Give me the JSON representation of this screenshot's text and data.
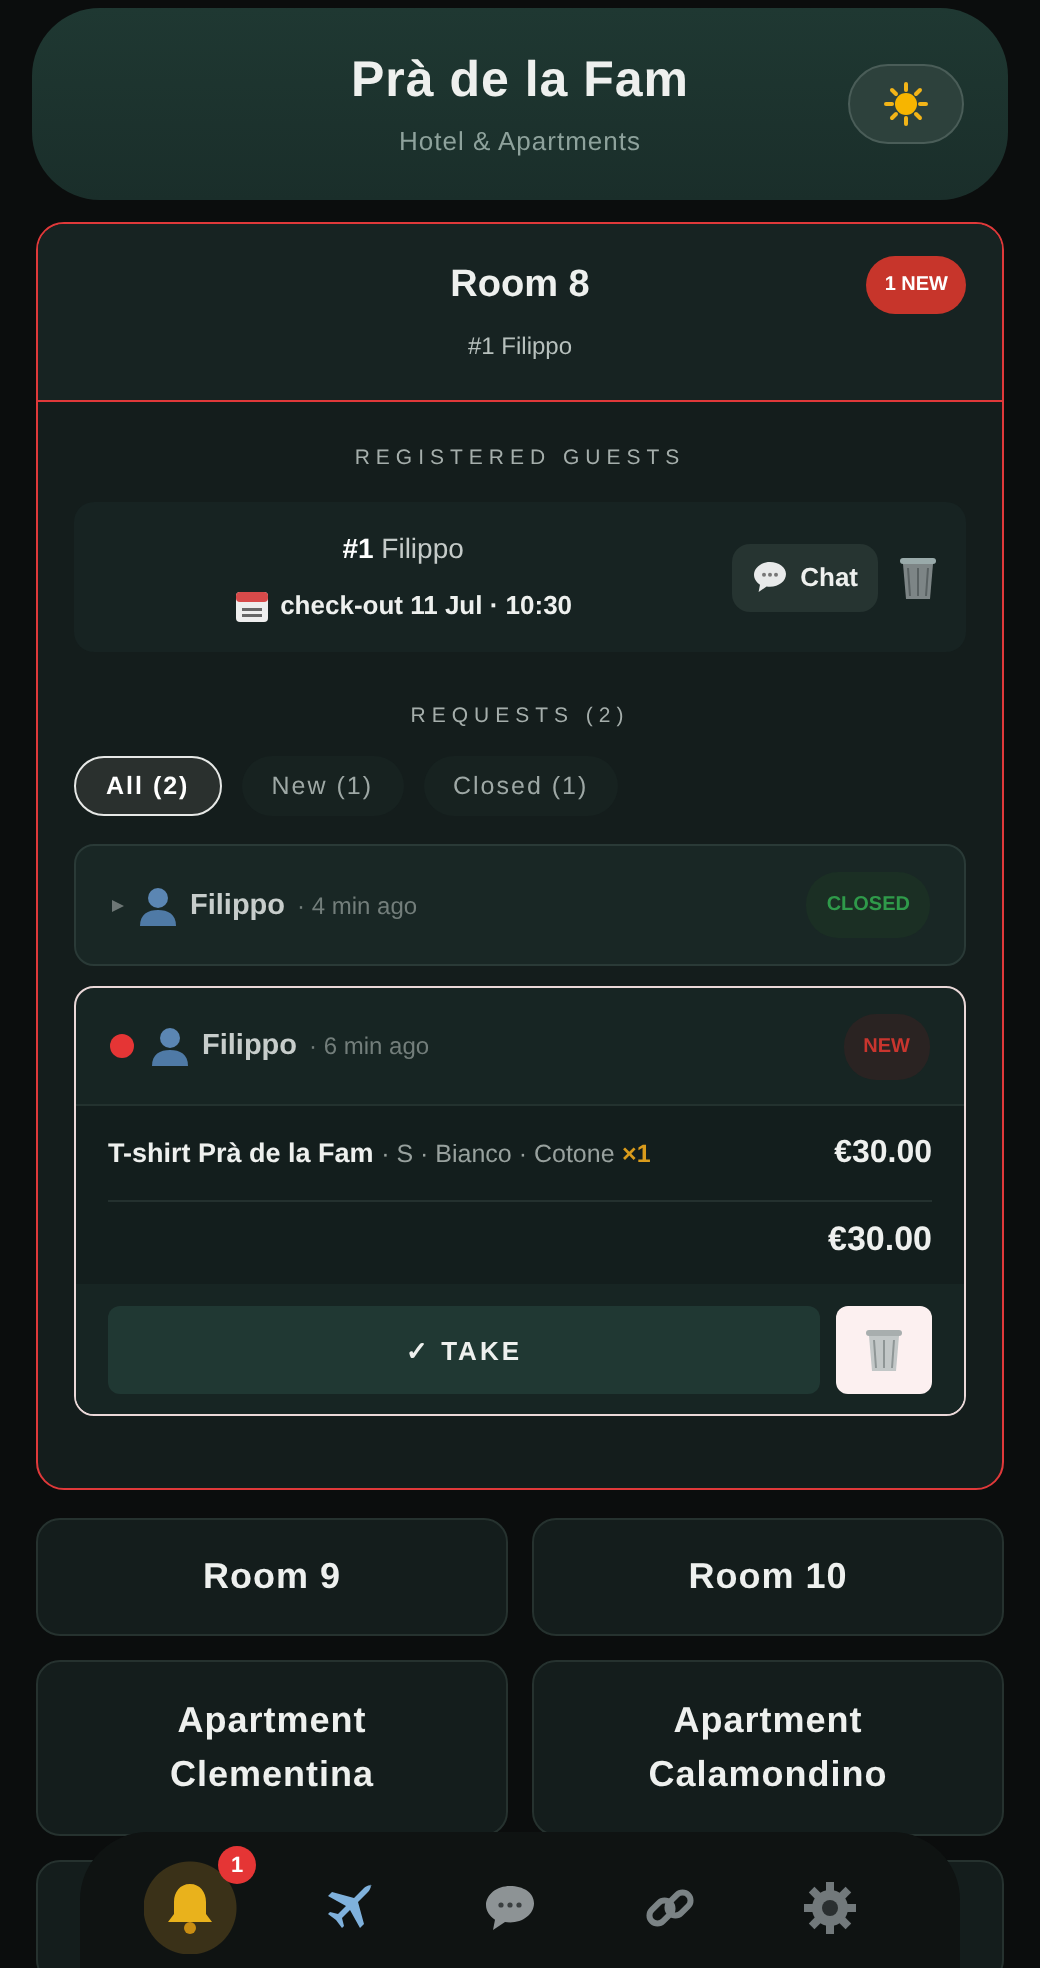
{
  "header": {
    "title": "Prà de la Fam",
    "subtitle": "Hotel & Apartments"
  },
  "room": {
    "name": "Room 8",
    "guest_line": "#1 Filippo",
    "badge": "1 NEW",
    "guests_heading": "REGISTERED GUESTS",
    "guests": [
      {
        "name": "**#1** Filippo",
        "checkout": "check-out 11 Jul · 10:30",
        "chat": "Chat"
      }
    ],
    "requests_heading": "REQUESTS (2)",
    "filters": [
      {
        "label": "All (2)",
        "selected": true
      },
      {
        "label": "New (1)",
        "selected": false
      },
      {
        "label": "Closed (1)",
        "selected": false
      }
    ],
    "requests": [
      {
        "guest": "Filippo",
        "time": "· 4 min ago",
        "status": "CLOSED",
        "kind": "closed",
        "expanded": false,
        "unread": false
      },
      {
        "guest": "Filippo",
        "time": "· 6 min ago",
        "status": "NEW",
        "kind": "new",
        "expanded": true,
        "unread": true,
        "items": [
          {
            "name": "T-shirt Prà de la Fam",
            "options": "· S · Bianco · Cotone",
            "qty": "×1",
            "price": "€30.00"
          }
        ],
        "total": "€30.00",
        "action": "✓ TAKE"
      }
    ]
  },
  "other_units": [
    "Room 9",
    "Room 10",
    "Apartment Clementina",
    "Apartment Calamondino"
  ],
  "nav": [
    {
      "kind": "bell",
      "selected": true,
      "badge": "1"
    },
    {
      "kind": "plane",
      "selected": false
    },
    {
      "kind": "chat",
      "selected": false
    },
    {
      "kind": "link",
      "selected": false
    },
    {
      "kind": "gear",
      "selected": false
    }
  ]
}
